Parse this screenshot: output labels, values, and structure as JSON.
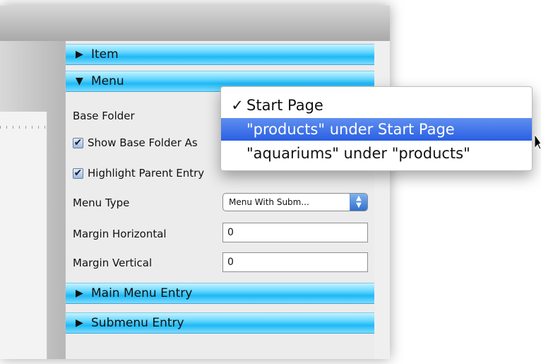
{
  "sections": {
    "item": {
      "arrow": "▶",
      "label": "Item"
    },
    "menu": {
      "arrow": "▼",
      "label": "Menu"
    },
    "main_menu_entry": {
      "arrow": "▶",
      "label": "Main Menu Entry"
    },
    "submenu_entry": {
      "arrow": "▶",
      "label": "Submenu Entry"
    }
  },
  "form": {
    "base_folder_label": "Base Folder",
    "show_base_folder": {
      "checked": true,
      "label": "Show Base Folder As"
    },
    "highlight_parent": {
      "checked": true,
      "label": "Highlight Parent Entry"
    },
    "menu_type_label": "Menu Type",
    "menu_type_value": "Menu With Subm...",
    "margin_horizontal_label": "Margin Horizontal",
    "margin_horizontal_value": "0",
    "margin_vertical_label": "Margin Vertical",
    "margin_vertical_value": "0"
  },
  "popup": {
    "check_mark": "✓",
    "items": [
      {
        "label": "Start Page",
        "checked": true,
        "highlighted": false
      },
      {
        "label": "\"products\" under Start Page",
        "checked": false,
        "highlighted": true
      },
      {
        "label": "\"aquariums\" under \"products\"",
        "checked": false,
        "highlighted": false
      }
    ]
  },
  "colors": {
    "section_header": "#1db9f5",
    "highlight": "#2a5fe3"
  }
}
